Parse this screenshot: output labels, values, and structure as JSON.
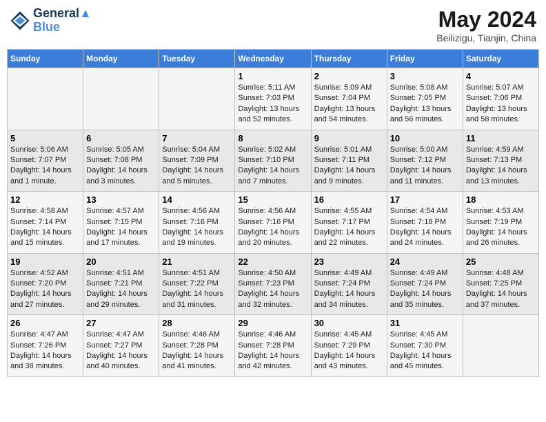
{
  "header": {
    "logo_line1": "General",
    "logo_line2": "Blue",
    "month_title": "May 2024",
    "subtitle": "Beilizigu, Tianjin, China"
  },
  "weekdays": [
    "Sunday",
    "Monday",
    "Tuesday",
    "Wednesday",
    "Thursday",
    "Friday",
    "Saturday"
  ],
  "weeks": [
    [
      {
        "day": "",
        "sunrise": "",
        "sunset": "",
        "daylight": ""
      },
      {
        "day": "",
        "sunrise": "",
        "sunset": "",
        "daylight": ""
      },
      {
        "day": "",
        "sunrise": "",
        "sunset": "",
        "daylight": ""
      },
      {
        "day": "1",
        "sunrise": "Sunrise: 5:11 AM",
        "sunset": "Sunset: 7:03 PM",
        "daylight": "Daylight: 13 hours and 52 minutes."
      },
      {
        "day": "2",
        "sunrise": "Sunrise: 5:09 AM",
        "sunset": "Sunset: 7:04 PM",
        "daylight": "Daylight: 13 hours and 54 minutes."
      },
      {
        "day": "3",
        "sunrise": "Sunrise: 5:08 AM",
        "sunset": "Sunset: 7:05 PM",
        "daylight": "Daylight: 13 hours and 56 minutes."
      },
      {
        "day": "4",
        "sunrise": "Sunrise: 5:07 AM",
        "sunset": "Sunset: 7:06 PM",
        "daylight": "Daylight: 13 hours and 58 minutes."
      }
    ],
    [
      {
        "day": "5",
        "sunrise": "Sunrise: 5:06 AM",
        "sunset": "Sunset: 7:07 PM",
        "daylight": "Daylight: 14 hours and 1 minute."
      },
      {
        "day": "6",
        "sunrise": "Sunrise: 5:05 AM",
        "sunset": "Sunset: 7:08 PM",
        "daylight": "Daylight: 14 hours and 3 minutes."
      },
      {
        "day": "7",
        "sunrise": "Sunrise: 5:04 AM",
        "sunset": "Sunset: 7:09 PM",
        "daylight": "Daylight: 14 hours and 5 minutes."
      },
      {
        "day": "8",
        "sunrise": "Sunrise: 5:02 AM",
        "sunset": "Sunset: 7:10 PM",
        "daylight": "Daylight: 14 hours and 7 minutes."
      },
      {
        "day": "9",
        "sunrise": "Sunrise: 5:01 AM",
        "sunset": "Sunset: 7:11 PM",
        "daylight": "Daylight: 14 hours and 9 minutes."
      },
      {
        "day": "10",
        "sunrise": "Sunrise: 5:00 AM",
        "sunset": "Sunset: 7:12 PM",
        "daylight": "Daylight: 14 hours and 11 minutes."
      },
      {
        "day": "11",
        "sunrise": "Sunrise: 4:59 AM",
        "sunset": "Sunset: 7:13 PM",
        "daylight": "Daylight: 14 hours and 13 minutes."
      }
    ],
    [
      {
        "day": "12",
        "sunrise": "Sunrise: 4:58 AM",
        "sunset": "Sunset: 7:14 PM",
        "daylight": "Daylight: 14 hours and 15 minutes."
      },
      {
        "day": "13",
        "sunrise": "Sunrise: 4:57 AM",
        "sunset": "Sunset: 7:15 PM",
        "daylight": "Daylight: 14 hours and 17 minutes."
      },
      {
        "day": "14",
        "sunrise": "Sunrise: 4:56 AM",
        "sunset": "Sunset: 7:16 PM",
        "daylight": "Daylight: 14 hours and 19 minutes."
      },
      {
        "day": "15",
        "sunrise": "Sunrise: 4:56 AM",
        "sunset": "Sunset: 7:16 PM",
        "daylight": "Daylight: 14 hours and 20 minutes."
      },
      {
        "day": "16",
        "sunrise": "Sunrise: 4:55 AM",
        "sunset": "Sunset: 7:17 PM",
        "daylight": "Daylight: 14 hours and 22 minutes."
      },
      {
        "day": "17",
        "sunrise": "Sunrise: 4:54 AM",
        "sunset": "Sunset: 7:18 PM",
        "daylight": "Daylight: 14 hours and 24 minutes."
      },
      {
        "day": "18",
        "sunrise": "Sunrise: 4:53 AM",
        "sunset": "Sunset: 7:19 PM",
        "daylight": "Daylight: 14 hours and 26 minutes."
      }
    ],
    [
      {
        "day": "19",
        "sunrise": "Sunrise: 4:52 AM",
        "sunset": "Sunset: 7:20 PM",
        "daylight": "Daylight: 14 hours and 27 minutes."
      },
      {
        "day": "20",
        "sunrise": "Sunrise: 4:51 AM",
        "sunset": "Sunset: 7:21 PM",
        "daylight": "Daylight: 14 hours and 29 minutes."
      },
      {
        "day": "21",
        "sunrise": "Sunrise: 4:51 AM",
        "sunset": "Sunset: 7:22 PM",
        "daylight": "Daylight: 14 hours and 31 minutes."
      },
      {
        "day": "22",
        "sunrise": "Sunrise: 4:50 AM",
        "sunset": "Sunset: 7:23 PM",
        "daylight": "Daylight: 14 hours and 32 minutes."
      },
      {
        "day": "23",
        "sunrise": "Sunrise: 4:49 AM",
        "sunset": "Sunset: 7:24 PM",
        "daylight": "Daylight: 14 hours and 34 minutes."
      },
      {
        "day": "24",
        "sunrise": "Sunrise: 4:49 AM",
        "sunset": "Sunset: 7:24 PM",
        "daylight": "Daylight: 14 hours and 35 minutes."
      },
      {
        "day": "25",
        "sunrise": "Sunrise: 4:48 AM",
        "sunset": "Sunset: 7:25 PM",
        "daylight": "Daylight: 14 hours and 37 minutes."
      }
    ],
    [
      {
        "day": "26",
        "sunrise": "Sunrise: 4:47 AM",
        "sunset": "Sunset: 7:26 PM",
        "daylight": "Daylight: 14 hours and 38 minutes."
      },
      {
        "day": "27",
        "sunrise": "Sunrise: 4:47 AM",
        "sunset": "Sunset: 7:27 PM",
        "daylight": "Daylight: 14 hours and 40 minutes."
      },
      {
        "day": "28",
        "sunrise": "Sunrise: 4:46 AM",
        "sunset": "Sunset: 7:28 PM",
        "daylight": "Daylight: 14 hours and 41 minutes."
      },
      {
        "day": "29",
        "sunrise": "Sunrise: 4:46 AM",
        "sunset": "Sunset: 7:28 PM",
        "daylight": "Daylight: 14 hours and 42 minutes."
      },
      {
        "day": "30",
        "sunrise": "Sunrise: 4:45 AM",
        "sunset": "Sunset: 7:29 PM",
        "daylight": "Daylight: 14 hours and 43 minutes."
      },
      {
        "day": "31",
        "sunrise": "Sunrise: 4:45 AM",
        "sunset": "Sunset: 7:30 PM",
        "daylight": "Daylight: 14 hours and 45 minutes."
      },
      {
        "day": "",
        "sunrise": "",
        "sunset": "",
        "daylight": ""
      }
    ]
  ]
}
